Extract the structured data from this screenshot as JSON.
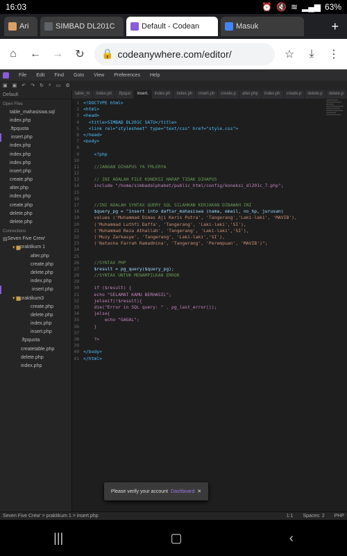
{
  "status": {
    "time": "16:03",
    "battery": "63%"
  },
  "browser_tabs": [
    {
      "title": "Ari",
      "favicon_color": "#d9a066",
      "active": false
    },
    {
      "title": "SIMBAD DL201C",
      "favicon_color": "#5f6368",
      "active": false
    },
    {
      "title": "Default - Codean",
      "favicon_color": "#8a5cd8",
      "active": true
    },
    {
      "title": "Masuk",
      "favicon_color": "#4285f4",
      "active": false
    }
  ],
  "url": "codeanywhere.com/editor/",
  "menu": [
    "File",
    "Edit",
    "Find",
    "Goto",
    "View",
    "Preferences",
    "Help"
  ],
  "sidebar": {
    "header": "Default",
    "open_files_label": "Open Files",
    "open_files": [
      "table_mahasiswa.sql",
      "index.php",
      ".ftpquota",
      "insert.php",
      "index.php",
      "index.php",
      "index.php",
      "insert.php",
      "create.php",
      "alter.php",
      "index.php",
      "create.php",
      "delete.php",
      "delete.php"
    ],
    "connections_label": "Connections",
    "tree": [
      {
        "label": "Seven Five Crew'",
        "level": 0,
        "folder": true
      },
      {
        "label": "praktikum 1",
        "level": 1,
        "folder": true
      },
      {
        "label": "alter.php",
        "level": 2
      },
      {
        "label": "create.php",
        "level": 2
      },
      {
        "label": "delete.php",
        "level": 2
      },
      {
        "label": "index.php",
        "level": 2
      },
      {
        "label": "insert.php",
        "level": 2,
        "selected": true
      },
      {
        "label": "praktikum3",
        "level": 1,
        "folder": true
      },
      {
        "label": "create.php",
        "level": 2
      },
      {
        "label": "delete.php",
        "level": 2
      },
      {
        "label": "index.php",
        "level": 2
      },
      {
        "label": "insert.php",
        "level": 2
      },
      {
        "label": ".ftpquota",
        "level": 1
      },
      {
        "label": "createtable.php",
        "level": 1
      },
      {
        "label": "delete.php",
        "level": 1
      },
      {
        "label": "index.php",
        "level": 1
      }
    ]
  },
  "editor_tabs": [
    "table_m",
    "index.ph",
    ".ftpquo",
    "insert.",
    "index.ph",
    "index.ph",
    "insert.ph",
    "create.p",
    "alter.php",
    "index.ph",
    "create.p",
    "delete.p",
    "delete.p"
  ],
  "code_lines": [
    "<!DOCTYPE html>",
    "<html>",
    "<head>",
    "  <title>SIMBAD DL201C SATU</title>",
    "  <link rel=\"stylesheet\" type=\"text/css\" href=\"style.css\">",
    "</head>",
    "<body>",
    "",
    "    <?php",
    "",
    "    //JANGAN DIHAPUS YA FMLERYA",
    "",
    "    // INI ADALAH FILE KONEKSI HARAP TIDAK DIHAPUS",
    "    include \"/home/simbadalphabet/public_html/config/koneksi_dl201c_7.php\";",
    "",
    "",
    "    //INI ADALAH SYNTAX QUERY SQL SILAHKAN KERJAKAN DIBAWAH INI",
    "    $query_pg = \"insert into daftar_mahasiswa (nama, email, no_hp, jurusan)",
    "    values ('Muhammad Dimas Aji Keris Putra', 'Tangerang','Laki-laki', 'MAVIB'),",
    "    ('Muhammad Luthfi Daffa', 'Tangerang', 'Laki-laki','SI'),",
    "    ('Muhammad Reza Athallah', 'Tangerang', 'Laki-laki','SI'),",
    "    ('Muzy Zarkasye', 'Tangerang', 'Laki-laki','SI'),",
    "    ('Natasha Farrah Ramadhina', 'Tangerang', 'Perempuan', 'MAVIB')\";",
    "",
    "",
    "    //SYNTAX PHP",
    "    $result = pg_query($query_pg);",
    "    //SYNTAX UNTUK MENAMPILKAN ERROR",
    "",
    "    if ($result) {",
    "    echo \"SELAMAT KAMU BERHASIL\";",
    "    }elseif(!$result){",
    "    die(\"Error in SQL query: \" . pg_last_error());",
    "    }else{",
    "        echo \"GAGAL\";",
    "    }",
    "",
    "    ?>",
    "",
    "</body>",
    "</html>"
  ],
  "toast": {
    "message": "Please verify your account",
    "link": "Dashboard"
  },
  "bottom": {
    "path": "Seven Five Crew' > praktikum 1 > insert.php",
    "position": "1:1",
    "spaces": "Spaces: 2",
    "lang": "PHP"
  }
}
